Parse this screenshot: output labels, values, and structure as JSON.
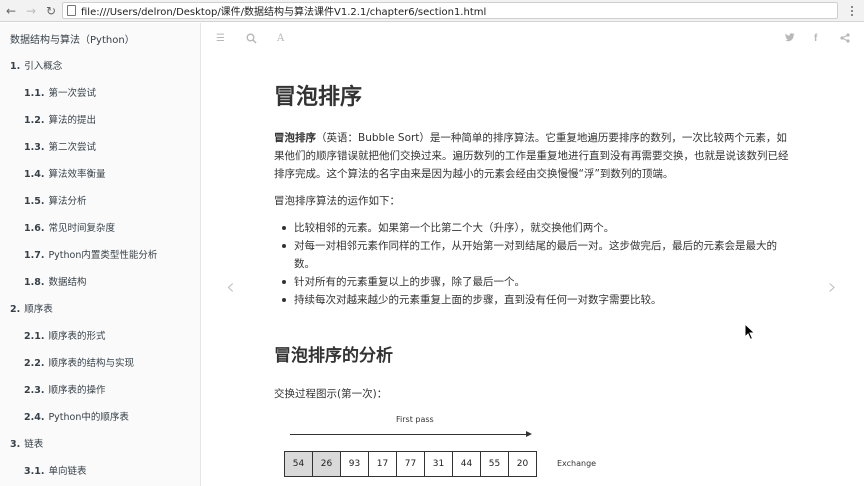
{
  "browser": {
    "url": "file:///Users/delron/Desktop/课件/数据结构与算法课件V1.2.1/chapter6/section1.html"
  },
  "sidebar": {
    "book_title": "数据结构与算法（Python）",
    "items": [
      {
        "num": "1.",
        "label": "引入概念",
        "level": 1
      },
      {
        "num": "1.1.",
        "label": "第一次尝试",
        "level": 2
      },
      {
        "num": "1.2.",
        "label": "算法的提出",
        "level": 2
      },
      {
        "num": "1.3.",
        "label": "第二次尝试",
        "level": 2
      },
      {
        "num": "1.4.",
        "label": "算法效率衡量",
        "level": 2
      },
      {
        "num": "1.5.",
        "label": "算法分析",
        "level": 2
      },
      {
        "num": "1.6.",
        "label": "常见时间复杂度",
        "level": 2
      },
      {
        "num": "1.7.",
        "label": "Python内置类型性能分析",
        "level": 2
      },
      {
        "num": "1.8.",
        "label": "数据结构",
        "level": 2
      },
      {
        "num": "2.",
        "label": "顺序表",
        "level": 1
      },
      {
        "num": "2.1.",
        "label": "顺序表的形式",
        "level": 2
      },
      {
        "num": "2.2.",
        "label": "顺序表的结构与实现",
        "level": 2
      },
      {
        "num": "2.3.",
        "label": "顺序表的操作",
        "level": 2
      },
      {
        "num": "2.4.",
        "label": "Python中的顺序表",
        "level": 2
      },
      {
        "num": "3.",
        "label": "链表",
        "level": 1
      },
      {
        "num": "3.1.",
        "label": "单向链表",
        "level": 2
      }
    ]
  },
  "toolbar": {
    "icons": [
      "menu-icon",
      "search-icon",
      "font-settings-icon",
      "twitter-icon",
      "facebook-icon",
      "share-icon"
    ]
  },
  "article": {
    "title": "冒泡排序",
    "intro_bold": "冒泡排序",
    "intro_rest": "（英语：Bubble Sort）是一种简单的排序算法。它重复地遍历要排序的数列，一次比较两个元素，如果他们的顺序错误就把他们交换过来。遍历数列的工作是重复地进行直到没有再需要交换，也就是说该数列已经排序完成。这个算法的名字由来是因为越小的元素会经由交换慢慢“浮”到数列的顶端。",
    "operation_heading": "冒泡排序算法的运作如下：",
    "steps": [
      "比较相邻的元素。如果第一个比第二个大（升序），就交换他们两个。",
      "对每一对相邻元素作同样的工作，从开始第一对到结尾的最后一对。这步做完后，最后的元素会是最大的数。",
      "针对所有的元素重复以上的步骤，除了最后一个。",
      "持续每次对越来越少的元素重复上面的步骤，直到没有任何一对数字需要比较。"
    ],
    "subtitle": "冒泡排序的分析",
    "figure_caption": "交换过程图示(第一次)：",
    "figure": {
      "pass_label": "First pass",
      "values": [
        "54",
        "26",
        "93",
        "17",
        "77",
        "31",
        "44",
        "55",
        "20"
      ],
      "highlighted": [
        0,
        1
      ],
      "action_label": "Exchange"
    }
  }
}
